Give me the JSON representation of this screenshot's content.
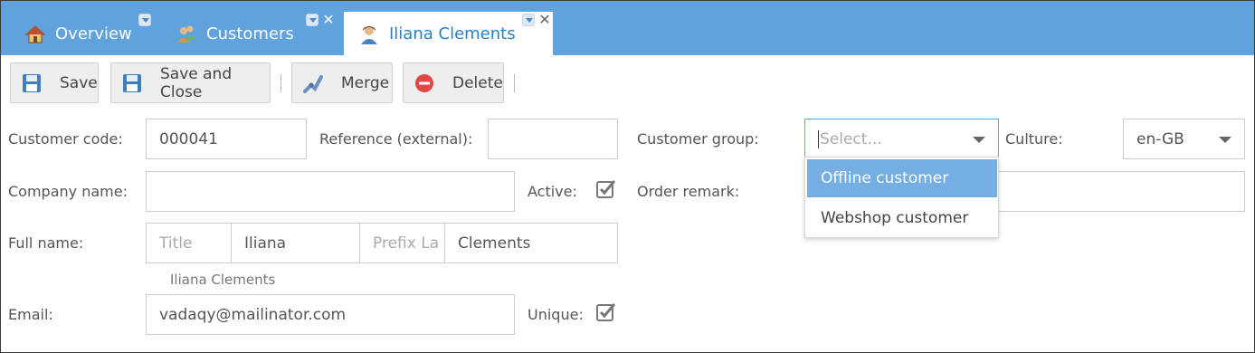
{
  "tabs": [
    {
      "label": "Overview",
      "icon": "home-icon"
    },
    {
      "label": "Customers",
      "icon": "customers-icon"
    },
    {
      "label": "Iliana Clements",
      "icon": "user-icon",
      "active": true
    }
  ],
  "toolbar": {
    "save_label": "Save",
    "save_close_label": "Save and Close",
    "merge_label": "Merge",
    "delete_label": "Delete"
  },
  "form": {
    "customer_code_label": "Customer code:",
    "customer_code_value": "000041",
    "reference_label": "Reference (external):",
    "reference_value": "",
    "customer_group_label": "Customer group:",
    "customer_group_placeholder": "Select...",
    "culture_label": "Culture:",
    "culture_value": "en-GB",
    "company_name_label": "Company name:",
    "company_name_value": "",
    "active_label": "Active:",
    "active_checked": true,
    "order_remark_label": "Order remark:",
    "order_remark_value": "",
    "full_name_label": "Full name:",
    "title_placeholder": "Title",
    "first_name_value": "Iliana",
    "prefix_placeholder": "Prefix La",
    "last_name_value": "Clements",
    "full_name_preview": "Iliana Clements",
    "email_label": "Email:",
    "email_value": "vadaqy@mailinator.com",
    "unique_label": "Unique:",
    "unique_checked": true
  },
  "customer_group_options": [
    {
      "label": "Offline customer",
      "highlighted": true
    },
    {
      "label": "Webshop customer",
      "highlighted": false
    }
  ],
  "colors": {
    "tabbar": "#5fa2dd",
    "active_tab_text": "#2d7fc6",
    "dropdown_highlight": "#74aee3"
  }
}
